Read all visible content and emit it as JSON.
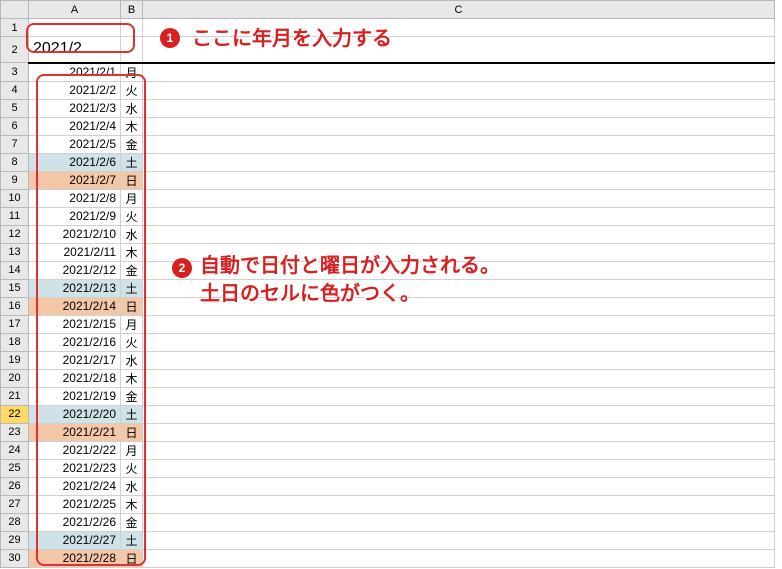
{
  "columns": [
    "A",
    "B",
    "C"
  ],
  "input_cell": "2021/2",
  "rows": [
    {
      "n": 1,
      "date": "",
      "dow": ""
    },
    {
      "n": 2,
      "date": "2021/2",
      "dow": ""
    },
    {
      "n": 3,
      "date": "2021/2/1",
      "dow": "月"
    },
    {
      "n": 4,
      "date": "2021/2/2",
      "dow": "火"
    },
    {
      "n": 5,
      "date": "2021/2/3",
      "dow": "水"
    },
    {
      "n": 6,
      "date": "2021/2/4",
      "dow": "木"
    },
    {
      "n": 7,
      "date": "2021/2/5",
      "dow": "金"
    },
    {
      "n": 8,
      "date": "2021/2/6",
      "dow": "土",
      "sat": true
    },
    {
      "n": 9,
      "date": "2021/2/7",
      "dow": "日",
      "sun": true
    },
    {
      "n": 10,
      "date": "2021/2/8",
      "dow": "月"
    },
    {
      "n": 11,
      "date": "2021/2/9",
      "dow": "火"
    },
    {
      "n": 12,
      "date": "2021/2/10",
      "dow": "水"
    },
    {
      "n": 13,
      "date": "2021/2/11",
      "dow": "木"
    },
    {
      "n": 14,
      "date": "2021/2/12",
      "dow": "金"
    },
    {
      "n": 15,
      "date": "2021/2/13",
      "dow": "土",
      "sat": true
    },
    {
      "n": 16,
      "date": "2021/2/14",
      "dow": "日",
      "sun": true
    },
    {
      "n": 17,
      "date": "2021/2/15",
      "dow": "月"
    },
    {
      "n": 18,
      "date": "2021/2/16",
      "dow": "火"
    },
    {
      "n": 19,
      "date": "2021/2/17",
      "dow": "水"
    },
    {
      "n": 20,
      "date": "2021/2/18",
      "dow": "木"
    },
    {
      "n": 21,
      "date": "2021/2/19",
      "dow": "金"
    },
    {
      "n": 22,
      "date": "2021/2/20",
      "dow": "土",
      "sat": true,
      "hl": true
    },
    {
      "n": 23,
      "date": "2021/2/21",
      "dow": "日",
      "sun": true
    },
    {
      "n": 24,
      "date": "2021/2/22",
      "dow": "月"
    },
    {
      "n": 25,
      "date": "2021/2/23",
      "dow": "火"
    },
    {
      "n": 26,
      "date": "2021/2/24",
      "dow": "水"
    },
    {
      "n": 27,
      "date": "2021/2/25",
      "dow": "木"
    },
    {
      "n": 28,
      "date": "2021/2/26",
      "dow": "金"
    },
    {
      "n": 29,
      "date": "2021/2/27",
      "dow": "土",
      "sat": true
    },
    {
      "n": 30,
      "date": "2021/2/28",
      "dow": "日",
      "sun": true
    }
  ],
  "annotations": {
    "badge1": "1",
    "callout1": "ここに年月を入力する",
    "badge2": "2",
    "callout2_line1": "自動で日付と曜日が入力される。",
    "callout2_line2": "土日のセルに色がつく。"
  }
}
